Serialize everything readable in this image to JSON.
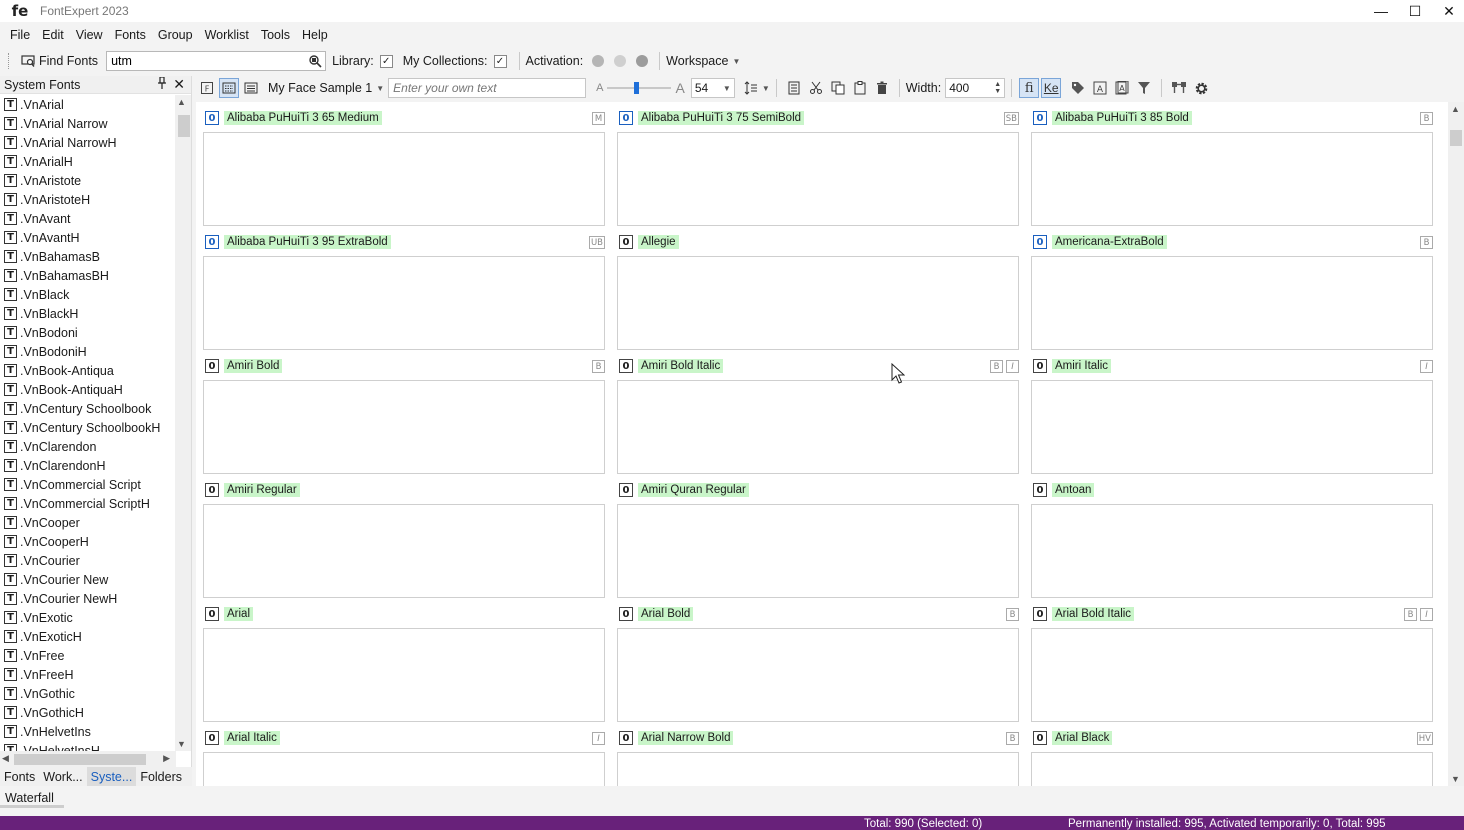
{
  "window": {
    "logo": "fe",
    "title": "FontExpert 2023",
    "minimize": "—",
    "maximize": "☐",
    "close": "✕"
  },
  "menu": [
    "File",
    "Edit",
    "View",
    "Fonts",
    "Group",
    "Worklist",
    "Tools",
    "Help"
  ],
  "toolbar1": {
    "find_label": "Find Fonts",
    "search_value": "utm",
    "library_label": "Library:",
    "collections_label": "My Collections:",
    "activation_label": "Activation:",
    "workspace_label": "Workspace",
    "check": "✓"
  },
  "sidebar": {
    "title": "System Fonts",
    "items": [
      ".VnArial",
      ".VnArial Narrow",
      ".VnArial NarrowH",
      ".VnArialH",
      ".VnAristote",
      ".VnAristoteH",
      ".VnAvant",
      ".VnAvantH",
      ".VnBahamasB",
      ".VnBahamasBH",
      ".VnBlack",
      ".VnBlackH",
      ".VnBodoni",
      ".VnBodoniH",
      ".VnBook-Antiqua",
      ".VnBook-AntiquaH",
      ".VnCentury Schoolbook",
      ".VnCentury SchoolbookH",
      ".VnClarendon",
      ".VnClarendonH",
      ".VnCommercial Script",
      ".VnCommercial ScriptH",
      ".VnCooper",
      ".VnCooperH",
      ".VnCourier",
      ".VnCourier New",
      ".VnCourier NewH",
      ".VnExotic",
      ".VnExoticH",
      ".VnFree",
      ".VnFreeH",
      ".VnGothic",
      ".VnGothicH",
      ".VnHelvetIns",
      ".VnHelvetInsH"
    ],
    "tabs": [
      "Fonts",
      "Work...",
      "Syste...",
      "Folders"
    ],
    "active_tab": 2
  },
  "toolbar2": {
    "sample_label": "My Face Sample 1",
    "own_text_placeholder": "Enter your own text",
    "size_small": "A",
    "size_large": "A",
    "size_value": "54",
    "size_fraction": 0.45,
    "width_label": "Width:",
    "width_value": "400"
  },
  "fonts": [
    {
      "name": "Alibaba PuHuiTi 3 65 Medium",
      "badges": [
        "M"
      ],
      "num": "0",
      "blue": true
    },
    {
      "name": "Alibaba PuHuiTi 3 75 SemiBold",
      "badges": [
        "SB"
      ],
      "num": "0",
      "blue": true
    },
    {
      "name": "Alibaba PuHuiTi 3 85 Bold",
      "badges": [
        "B"
      ],
      "num": "0",
      "blue": true
    },
    {
      "name": "Alibaba PuHuiTi 3 95 ExtraBold",
      "badges": [
        "UB"
      ],
      "num": "0",
      "blue": true
    },
    {
      "name": "Allegie",
      "badges": [],
      "num": "0",
      "blue": false
    },
    {
      "name": "Americana-ExtraBold",
      "badges": [
        "B"
      ],
      "num": "0",
      "blue": true
    },
    {
      "name": "Amiri Bold",
      "badges": [
        "B"
      ],
      "num": "0",
      "blue": false
    },
    {
      "name": "Amiri Bold Italic",
      "badges": [
        "B",
        "I"
      ],
      "num": "0",
      "blue": false
    },
    {
      "name": "Amiri Italic",
      "badges": [
        "I"
      ],
      "num": "0",
      "blue": false
    },
    {
      "name": "Amiri Regular",
      "badges": [],
      "num": "0",
      "blue": false
    },
    {
      "name": "Amiri Quran Regular",
      "badges": [],
      "num": "0",
      "blue": false
    },
    {
      "name": "Antoan",
      "badges": [],
      "num": "0",
      "blue": false
    },
    {
      "name": "Arial",
      "badges": [],
      "num": "0",
      "blue": false
    },
    {
      "name": "Arial Bold",
      "badges": [
        "B"
      ],
      "num": "0",
      "blue": false
    },
    {
      "name": "Arial Bold Italic",
      "badges": [
        "B",
        "I"
      ],
      "num": "0",
      "blue": false
    },
    {
      "name": "Arial Italic",
      "badges": [
        "I"
      ],
      "num": "0",
      "blue": false
    },
    {
      "name": "Arial Narrow Bold",
      "badges": [
        "B"
      ],
      "num": "0",
      "blue": false
    },
    {
      "name": "Arial Black",
      "badges": [
        "HV"
      ],
      "num": "0",
      "blue": false
    }
  ],
  "bottom": {
    "waterfall_label": "Waterfall"
  },
  "status": {
    "total": "Total: 990 (Selected: 0)",
    "installed": "Permanently installed: 995, Activated temporarily: 0, Total: 995"
  },
  "colors": {
    "status_bg": "#68217a",
    "name_highlight": "#c9f5c9",
    "accent": "#1e6fd9"
  }
}
